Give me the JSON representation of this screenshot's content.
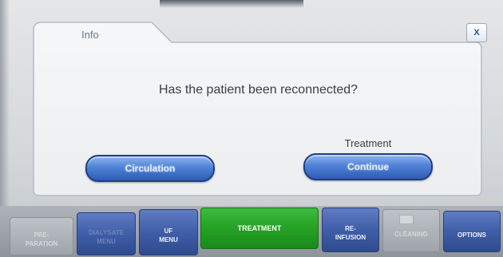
{
  "dialog": {
    "tab_title": "Info",
    "close_label": "X",
    "question": "Has the patient been reconnected?",
    "left_button_label": "Circulation",
    "right_button_caption": "Treatment",
    "right_button_label": "Continue"
  },
  "menu": {
    "items": [
      {
        "label": "PRE-\nPARATION",
        "state": "disabled"
      },
      {
        "label": "DIALYSATE\nMENU",
        "state": "normal"
      },
      {
        "label": "UF\nMENU",
        "state": "normal"
      },
      {
        "label": "TREATMENT",
        "state": "active"
      },
      {
        "label": "RE-\nINFUSION",
        "state": "normal"
      },
      {
        "label": "CLEANING",
        "state": "disabled"
      },
      {
        "label": "OPTIONS",
        "state": "normal"
      }
    ]
  },
  "colors": {
    "button_blue": "#4f82d6",
    "active_green": "#25a225",
    "disabled_grey": "#aeb3b9"
  }
}
